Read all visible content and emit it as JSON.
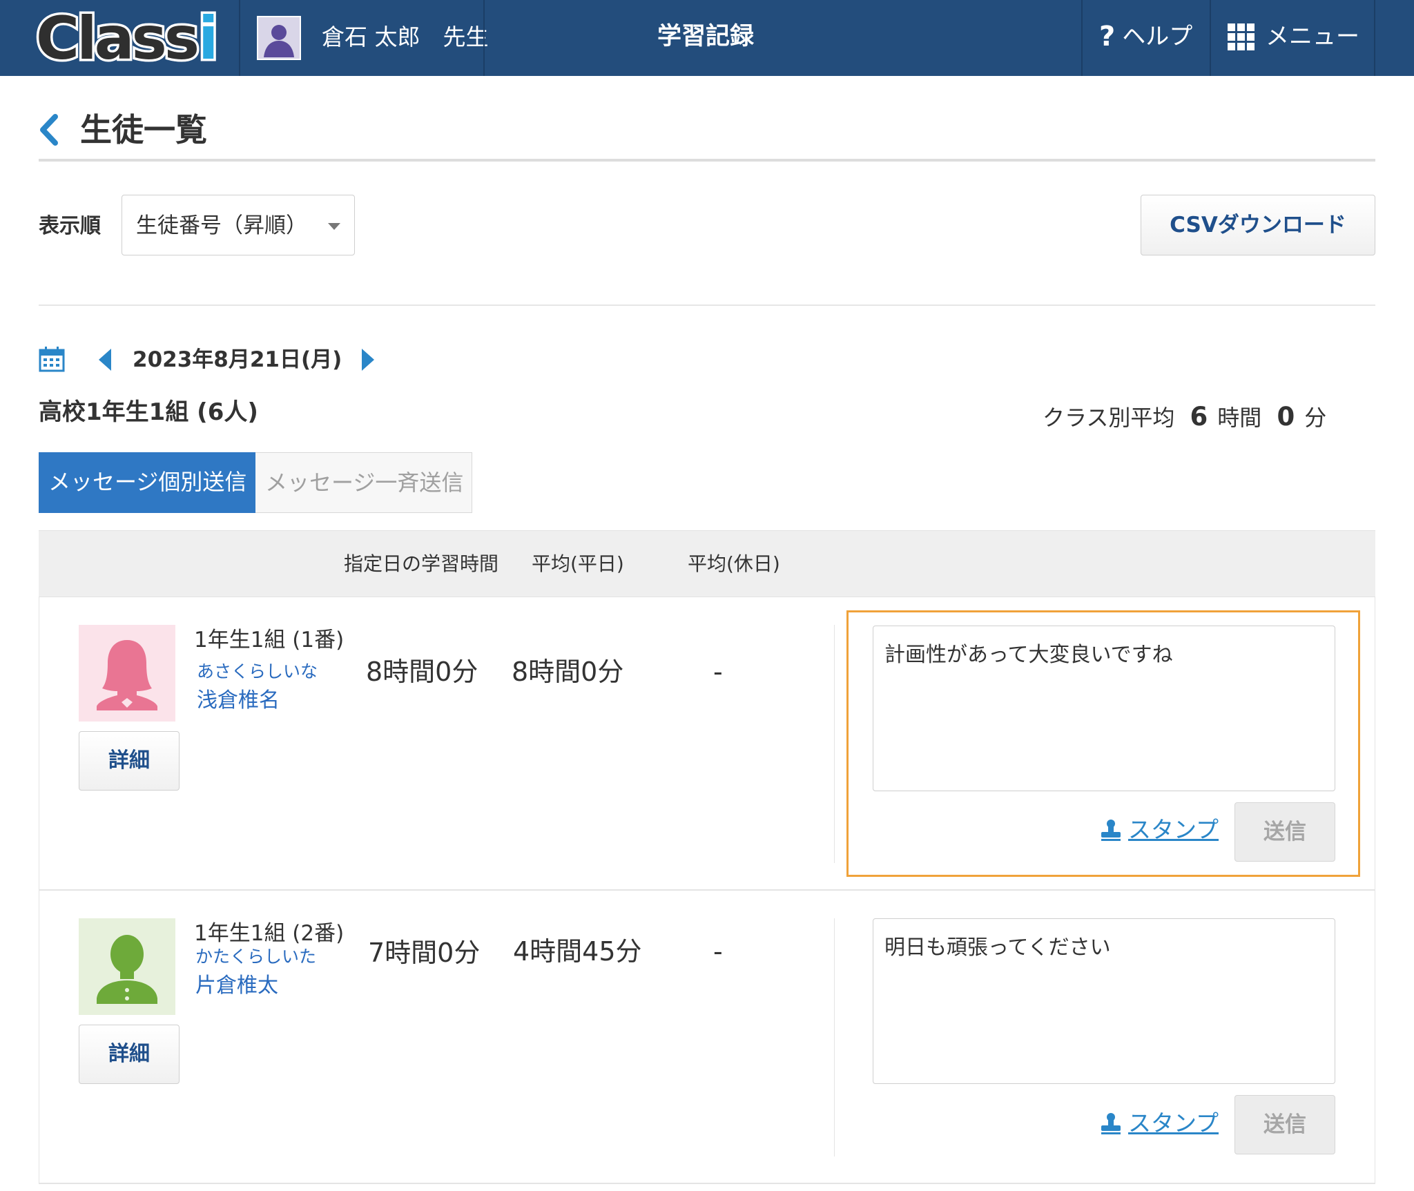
{
  "header": {
    "logo_text": "Class",
    "logo_accent": "i",
    "teacher_name": "倉石 太郎　先生",
    "app_title": "学習記録",
    "help_label": "ヘルプ",
    "menu_label": "メニュー",
    "bar_color": "#234d7c"
  },
  "page": {
    "title": "生徒一覧",
    "sort_label": "表示順",
    "sort_value": "生徒番号（昇順）",
    "csv_button": "CSVダウンロード",
    "date": "2023年8月21日(月)",
    "class_name": "高校1年生1組 (6人)",
    "class_avg_label": "クラス別平均",
    "class_avg_hours": "6",
    "hours_unit": "時間",
    "class_avg_minutes": "0",
    "minutes_unit": "分"
  },
  "tabs": [
    {
      "label": "メッセージ個別送信",
      "active": true
    },
    {
      "label": "メッセージ一斉送信",
      "active": false
    }
  ],
  "columns": [
    "指定日の学習時間",
    "平均(平日)",
    "平均(休日)"
  ],
  "students": [
    {
      "class_no": "1年生1組 (1番)",
      "kana": "あさくらしいな",
      "name": "浅倉椎名",
      "detail_label": "詳細",
      "day_time": "8時間0分",
      "weekday_avg": "8時間0分",
      "holiday_avg": "-",
      "message": "計画性があって大変良いですね",
      "stamp_label": "スタンプ",
      "send_label": "送信",
      "avatar_color": "#e97593",
      "avatar_bg": "#fbe3ea"
    },
    {
      "class_no": "1年生1組 (2番)",
      "kana": "かたくらしいた",
      "name": "片倉椎太",
      "detail_label": "詳細",
      "day_time": "7時間0分",
      "weekday_avg": "4時間45分",
      "holiday_avg": "-",
      "message": "明日も頑張ってください",
      "stamp_label": "スタンプ",
      "send_label": "送信",
      "avatar_color": "#6eaa3a",
      "avatar_bg": "#e7f1dc"
    }
  ]
}
